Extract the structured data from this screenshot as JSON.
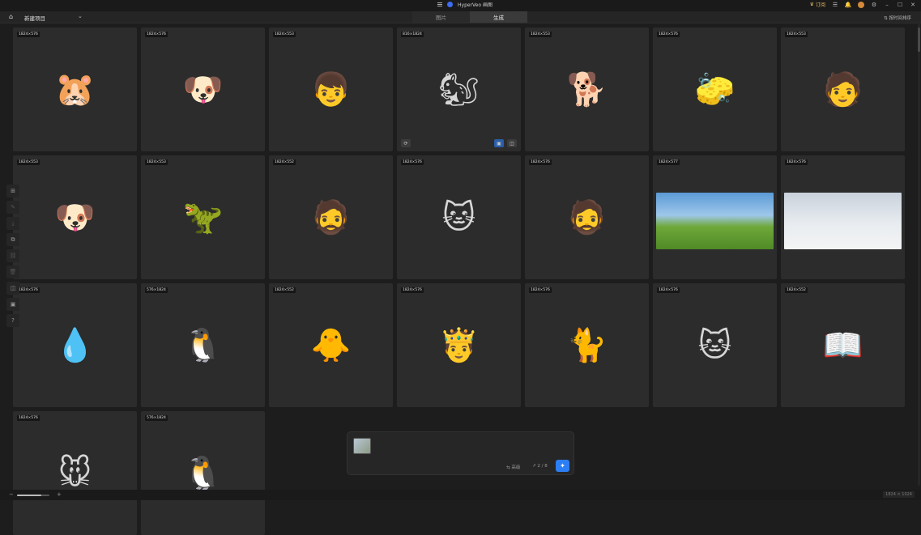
{
  "app": {
    "title": "HyperVeo 画图"
  },
  "titlebar": {
    "subscribe_label": "订阅"
  },
  "toolbar": {
    "project_name": "新建项目",
    "tabs": [
      {
        "label": "图片"
      },
      {
        "label": "生成"
      }
    ],
    "sort_label": "⇅ 按时间排序"
  },
  "cards": [
    {
      "dim": "1824×576",
      "subject": "hamster",
      "icon": "🐹"
    },
    {
      "dim": "1824×576",
      "subject": "dog",
      "icon": "🐶"
    },
    {
      "dim": "1824×553",
      "subject": "boy-at-desk",
      "icon": "👦"
    },
    {
      "dim": "816×1824",
      "subject": "squirrel-cart",
      "icon": "🐿"
    },
    {
      "dim": "1824×553",
      "subject": "beagle",
      "icon": "🐕"
    },
    {
      "dim": "1824×576",
      "subject": "sponge",
      "icon": "🧽"
    },
    {
      "dim": "1824×553",
      "subject": "boy-on-beanbag",
      "icon": "🧑"
    },
    {
      "dim": "1824×553",
      "subject": "pugs",
      "icon": "🐶"
    },
    {
      "dim": "1824×553",
      "subject": "dinosaur",
      "icon": "🦖"
    },
    {
      "dim": "1824×552",
      "subject": "man-with-book",
      "icon": "🧔"
    },
    {
      "dim": "1824×576",
      "subject": "cat-mug",
      "icon": "🐱"
    },
    {
      "dim": "1824×576",
      "subject": "man-camera",
      "icon": "🧔"
    },
    {
      "dim": "1824×577",
      "subject": "meadow",
      "icon": ""
    },
    {
      "dim": "1824×576",
      "subject": "bed-scene",
      "icon": ""
    },
    {
      "dim": "1824×576",
      "subject": "drop-bike",
      "icon": "💧"
    },
    {
      "dim": "576×1824",
      "subject": "penguin-bear",
      "icon": "🐧"
    },
    {
      "dim": "1824×552",
      "subject": "chick",
      "icon": "🐥"
    },
    {
      "dim": "1824×576",
      "subject": "king",
      "icon": "🤴"
    },
    {
      "dim": "1824×576",
      "subject": "kitten",
      "icon": "🐈"
    },
    {
      "dim": "1824×576",
      "subject": "two-kittens",
      "icon": "🐱"
    },
    {
      "dim": "1824×552",
      "subject": "open-book",
      "icon": "📖"
    },
    {
      "dim": "1824×576",
      "subject": "mouse",
      "icon": "🐭"
    },
    {
      "dim": "576×1824",
      "subject": "penguin-bear-2",
      "icon": "🐧"
    }
  ],
  "prompt": {
    "advanced_label": "⇆ 高级",
    "count_label": "↗ 2 / 8"
  },
  "statusbar": {
    "resolution": "1824 × 1024"
  },
  "colors": {
    "accent": "#2c7ef5",
    "bg": "#1d1d1d",
    "card": "#2c2c2c"
  }
}
